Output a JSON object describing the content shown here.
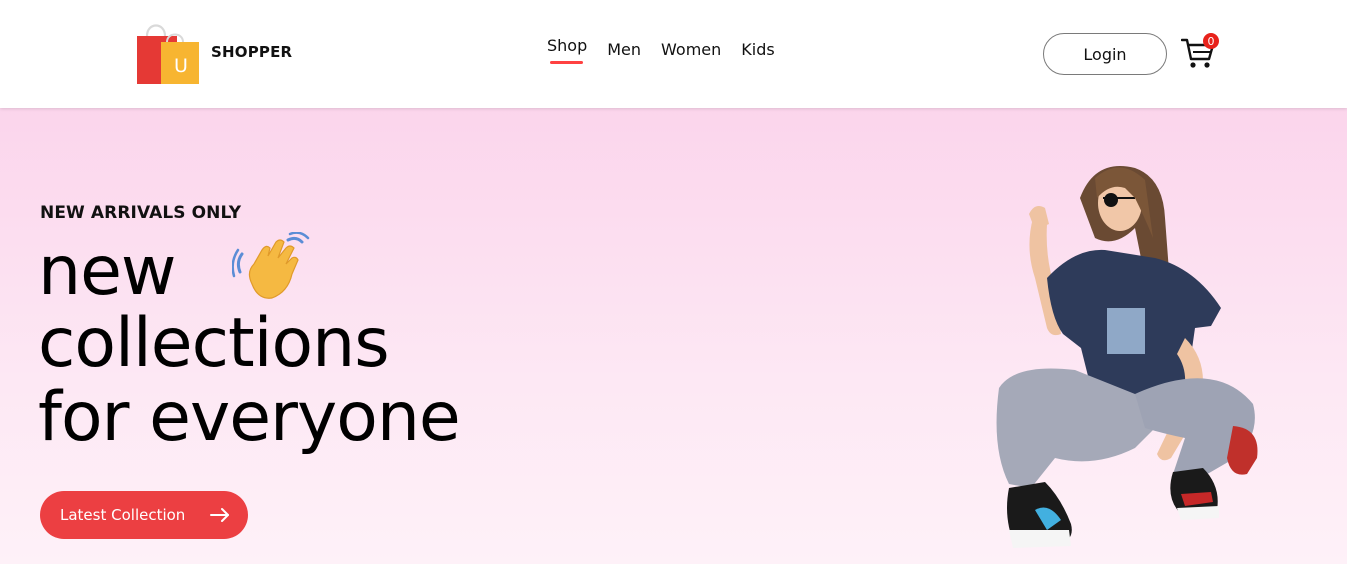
{
  "brand": {
    "name": "SHOPPER",
    "logo_letter": "U",
    "colors": {
      "bag_red": "#e53935",
      "bag_yellow": "#f7b531"
    }
  },
  "nav": {
    "items": [
      {
        "label": "Shop",
        "active": true
      },
      {
        "label": "Men",
        "active": false
      },
      {
        "label": "Women",
        "active": false
      },
      {
        "label": "Kids",
        "active": false
      }
    ],
    "active_color": "#ff4141"
  },
  "actions": {
    "login_label": "Login",
    "cart_count": "0",
    "cart_icon": "cart-icon"
  },
  "hero": {
    "tag": "NEW ARRIVALS ONLY",
    "headline_line1": "new",
    "headline_line2": "collections",
    "headline_line3": "for everyone",
    "wave_icon": "waving-hand-icon",
    "cta_label": "Latest Collection",
    "cta_icon": "arrow-right-icon",
    "cta_color": "#ec3f42",
    "background_top": "#fbd5ec",
    "background_bottom": "#fef1f8"
  }
}
